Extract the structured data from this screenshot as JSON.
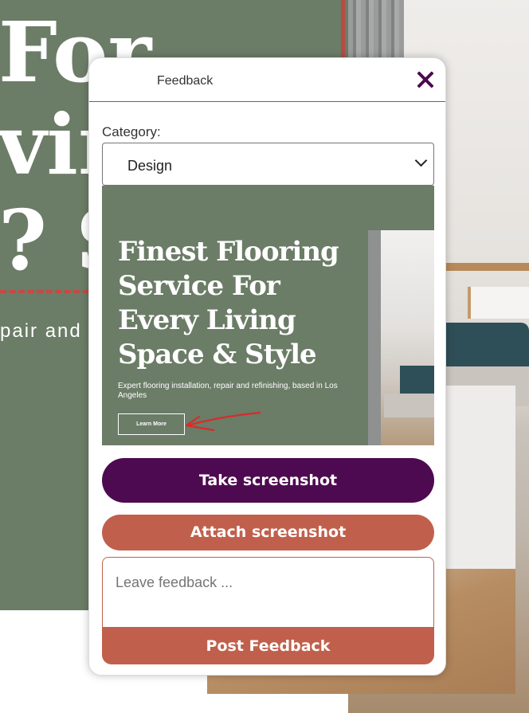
{
  "background": {
    "headline_lines": [
      "For",
      "vin",
      "? S"
    ],
    "subtitle_fragment": "pair and"
  },
  "widget": {
    "title": "Feedback",
    "close_icon": "close-icon",
    "category_label": "Category:",
    "category_value": "Design",
    "preview": {
      "headline_lines": [
        "Finest Flooring",
        "Service For",
        "Every Living",
        "Space & Style"
      ],
      "subtitle": "Expert flooring installation, repair and refinishing, based in Los Angeles",
      "button_label": "Learn More",
      "annotation_color": "#d92b2b"
    },
    "take_screenshot_label": "Take screenshot",
    "attach_screenshot_label": "Attach screenshot",
    "feedback_placeholder": "Leave feedback ...",
    "post_label": "Post Feedback"
  },
  "colors": {
    "primary": "#4e0a50",
    "accent": "#c0604c",
    "page_green": "#6b7c67"
  }
}
